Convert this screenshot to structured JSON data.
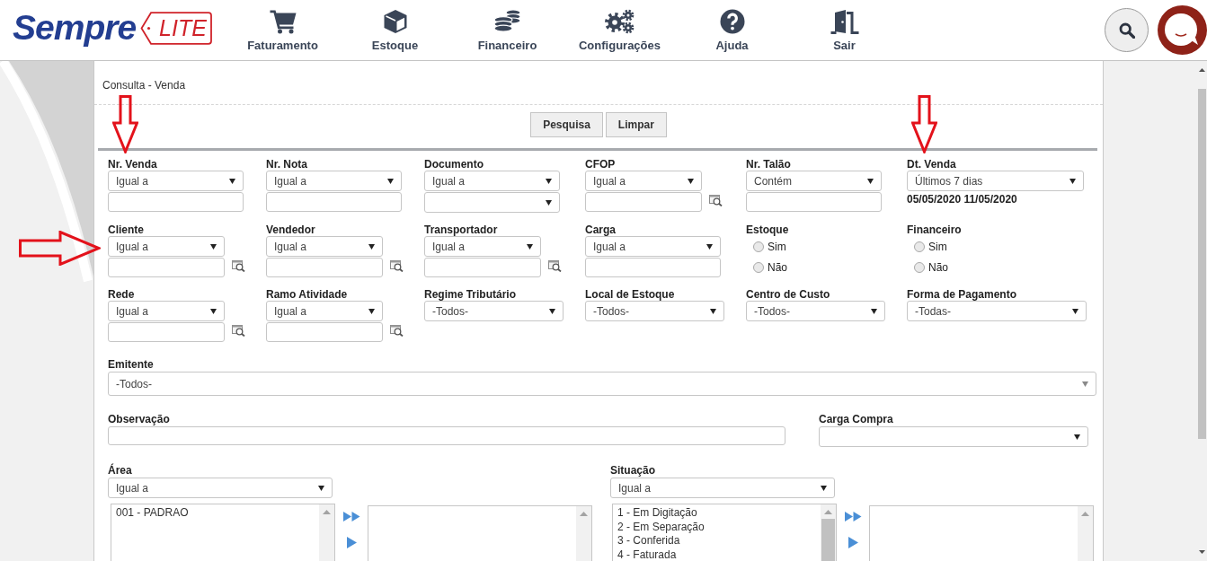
{
  "header": {
    "logo": {
      "name": "Sempre",
      "badge": "LITE"
    },
    "nav": [
      {
        "label": "Faturamento"
      },
      {
        "label": "Estoque"
      },
      {
        "label": "Financeiro"
      },
      {
        "label": "Configurações"
      },
      {
        "label": "Ajuda"
      },
      {
        "label": "Sair"
      }
    ]
  },
  "form": {
    "title": "Consulta - Venda",
    "buttons": [
      "Pesquisa",
      "Limpar"
    ],
    "filters": [
      {
        "label": "Nr. Venda",
        "kind": "text",
        "operator": "Igual a",
        "lookup": false,
        "arrow": {
          "kind": "down"
        }
      },
      {
        "label": "Nr. Nota",
        "kind": "text",
        "operator": "Igual a",
        "lookup": false
      },
      {
        "label": "Documento",
        "kind": "pair",
        "operator": "Igual a"
      },
      {
        "label": "CFOP",
        "kind": "text",
        "operator": "Igual a",
        "lookup": true
      },
      {
        "label": "Nr. Talão",
        "kind": "text",
        "operator": "Contém",
        "lookup": false
      },
      {
        "label": "Dt. Venda",
        "kind": "period",
        "value": "Últimos 7 dias",
        "range": "05/05/2020 11/05/2020",
        "arrow": {
          "kind": "down"
        }
      },
      {
        "label": "Cliente",
        "kind": "text",
        "operator": "Igual a",
        "lookup": true,
        "arrow": {
          "kind": "right"
        }
      },
      {
        "label": "Vendedor",
        "kind": "text",
        "operator": "Igual a",
        "lookup": true
      },
      {
        "label": "Transportador",
        "kind": "text",
        "operator": "Igual a",
        "lookup": true
      },
      {
        "label": "Carga",
        "kind": "text",
        "operator": "Igual a",
        "lookup": false
      },
      {
        "label": "Estoque",
        "kind": "radio",
        "options": [
          {
            "label": "Sim",
            "selected": false
          },
          {
            "label": "Não",
            "selected": false
          }
        ]
      },
      {
        "label": "Financeiro",
        "kind": "radio",
        "options": [
          {
            "label": "Sim",
            "selected": false
          },
          {
            "label": "Não",
            "selected": false
          }
        ]
      },
      {
        "label": "Rede",
        "kind": "text",
        "operator": "Igual a",
        "lookup": true
      },
      {
        "label": "Ramo Atividade",
        "kind": "text",
        "operator": "Igual a",
        "lookup": true
      },
      {
        "label": "Regime Tributário",
        "kind": "choice",
        "value": "-Todos-"
      },
      {
        "label": "Local de Estoque",
        "kind": "choice",
        "value": "-Todos-"
      },
      {
        "label": "Centro de Custo",
        "kind": "choice",
        "value": "-Todos-"
      },
      {
        "label": "Forma de Pagamento",
        "kind": "choice",
        "value": "-Todas-"
      }
    ],
    "emitente": {
      "label": "Emitente",
      "value": "-Todos-"
    },
    "observacao": {
      "label": "Observação"
    },
    "carga_compra": {
      "label": "Carga Compra"
    },
    "transfer_lists": [
      {
        "label": "Área",
        "operator": "Igual a",
        "available": [
          "001 - PADRAO"
        ]
      },
      {
        "label": "Situação",
        "operator": "Igual a",
        "available": [
          "1 - Em Digitação",
          "2 - Em Separação",
          "3 - Conferida",
          "4 - Faturada"
        ]
      }
    ]
  }
}
